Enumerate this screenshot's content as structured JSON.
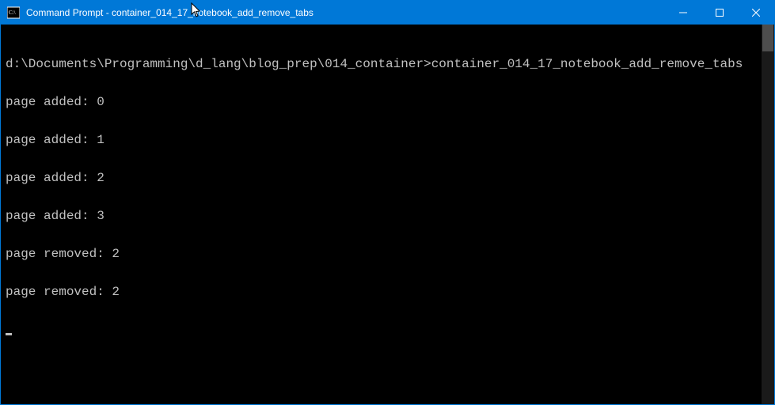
{
  "window": {
    "title": "Command Prompt - container_014_17_notebook_add_remove_tabs"
  },
  "terminal": {
    "prompt_path": "d:\\Documents\\Programming\\d_lang\\blog_prep\\014_container>",
    "command": "container_014_17_notebook_add_remove_tabs",
    "output_lines": [
      "page added: 0",
      "page added: 1",
      "page added: 2",
      "page added: 3",
      "page removed: 2",
      "page removed: 2"
    ]
  }
}
